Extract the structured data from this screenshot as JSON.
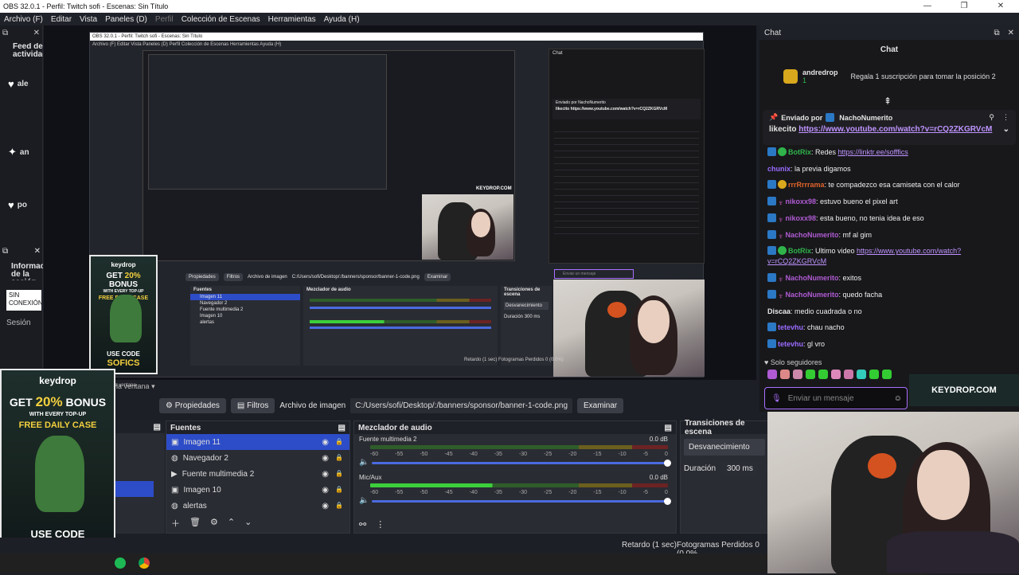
{
  "window": {
    "title": "OBS 32.0.1 - Perfil: Twitch sofi - Escenas: Sin Título",
    "controls": [
      "—",
      "❐",
      "✕"
    ]
  },
  "menu": {
    "items": [
      "Archivo (F)",
      "Editar",
      "Vista",
      "Paneles (D)",
      "Perfil",
      "Colección de Escenas",
      "Herramientas",
      "Ayuda (H)"
    ]
  },
  "left_dock": {
    "title": "Feed de actividad",
    "rows": [
      "ale",
      "an",
      "po"
    ],
    "info_title": "Información de la sesión",
    "status": "SIN CONEXIÓN",
    "session": "Sesión"
  },
  "preview": {
    "inner_title": "OBS 32.0.1 - Perfil: Twitch sofi - Escenas: Sin Título",
    "inner_menu": "Archivo (F)   Editar   Vista   Paneles (D)   Perfil   Colección de Escenas   Herramientas   Ayuda (H)",
    "inner_chat_title": "Chat",
    "inner_chat_pinned": "Enviado por NachoNumerito",
    "inner_chat_link": "likecito https://www.youtube.com/watch?v=rCQ2ZKGRVcM",
    "inner_chat_placeholder": "Enviar un mensaje",
    "inner_keydrop": "KEYDROP.COM",
    "inner_sources_title": "Fuentes",
    "inner_mixer_title": "Mezclador de audio",
    "inner_transitions_title": "Transiciones de escena",
    "inner_transition": "Desvanecimiento",
    "inner_duration": "Duración",
    "inner_duration_value": "300 ms",
    "inner_sources": [
      "Imagen 11",
      "Navegador 2",
      "Fuente multimedia 2",
      "Imagen 10",
      "alertas"
    ],
    "inner_btn_props": "Propiedades",
    "inner_btn_filters": "Filtros",
    "inner_file_label": "Archivo de imagen",
    "inner_path": "C:/Users/sofi/Desktop/:/banners/sponsor/banner-1-code.png",
    "inner_browse": "Examinar",
    "inner_status": "Retardo (1 sec)     Fotogramas Perdidos 0 (0.0%)",
    "window_label": "la ventana"
  },
  "ad": {
    "logo": "keydrop",
    "line1_a": "GET ",
    "line1_b": "20%",
    "line1_c": " BONUS",
    "line2": "WITH EVERY TOP-UP",
    "line3": "FREE DAILY CASE",
    "line4": "USE CODE",
    "line5": "SOFICS"
  },
  "controls": {
    "window_label": "la ventana",
    "properties": "Propiedades",
    "filters": "Filtros",
    "file_label": "Archivo de imagen",
    "path": "C:/Users/sofi/Desktop/:/banners/sponsor/banner-1-code.png",
    "browse": "Examinar"
  },
  "sources": {
    "title": "Fuentes",
    "items": [
      {
        "label": "Imagen 11",
        "selected": true,
        "icon": "image-icon"
      },
      {
        "label": "Navegador 2",
        "selected": false,
        "icon": "globe-icon"
      },
      {
        "label": "Fuente multimedia 2",
        "selected": false,
        "icon": "play-icon"
      },
      {
        "label": "Imagen 10",
        "selected": false,
        "icon": "image-icon"
      },
      {
        "label": "alertas",
        "selected": false,
        "icon": "globe-icon"
      }
    ]
  },
  "mixer": {
    "title": "Mezclador de audio",
    "channels": [
      {
        "name": "Fuente multimedia 2",
        "db": "0.0 dB",
        "level": 0.0
      },
      {
        "name": "Mic/Aux",
        "db": "0.0 dB",
        "level": 0.41
      }
    ],
    "scale": [
      "-60",
      "-55",
      "-50",
      "-45",
      "-40",
      "-35",
      "-30",
      "-25",
      "-20",
      "-15",
      "-10",
      "-5",
      "0"
    ]
  },
  "transitions": {
    "title": "Transiciones de escena",
    "selected": "Desvanecimiento",
    "duration_label": "Duración",
    "duration_value": "300 ms"
  },
  "status": {
    "delay": "Retardo (1 sec)",
    "frames": "Fotogramas Perdidos 0 (0.0%"
  },
  "chat": {
    "dock_title": "Chat",
    "header": "Chat",
    "gift_user": "andredrop",
    "gift_count": "1",
    "gift_text": "Regala 1 suscripción para tomar la posición 2",
    "pinned_by_label": "Enviado por",
    "pinned_by_user": "NachoNumerito",
    "pinned_text": "likecito",
    "pinned_link": "https://www.youtube.com/watch?v=rCQ2ZKGRVcM",
    "messages": [
      {
        "user": "BotRix",
        "sep": ": ",
        "text": "Redes ",
        "link": "https://linktr.ee/sofffics",
        "color": "g"
      },
      {
        "user": "chunix",
        "sep": ": ",
        "text": "la previa digamos",
        "link": "",
        "color": "v"
      },
      {
        "user": "rrrRrrrama",
        "sep": ": ",
        "text": "te compadezco esa camiseta con el calor",
        "link": "",
        "color": "o"
      },
      {
        "user": "nikoxx98",
        "sep": ": ",
        "text": "estuvo bueno el pixel art",
        "link": "",
        "color": "p"
      },
      {
        "user": "nikoxx98",
        "sep": ": ",
        "text": "esta bueno, no tenia idea de eso",
        "link": "",
        "color": "p"
      },
      {
        "user": "NachoNumerito",
        "sep": ": ",
        "text": "mf al gim",
        "link": "",
        "color": "p"
      },
      {
        "user": "BotRix",
        "sep": ": ",
        "text": "Ultimo video ",
        "link": "https://www.youtube.com/watch?v=rCQ2ZKGRVcM",
        "color": "g"
      },
      {
        "user": "NachoNumerito",
        "sep": ": ",
        "text": "exitos",
        "link": "",
        "color": "p"
      },
      {
        "user": "NachoNumerito",
        "sep": ": ",
        "text": "quedo facha",
        "link": "",
        "color": "p"
      },
      {
        "user": "Discaa",
        "sep": ": ",
        "text": "medio cuadrada o no",
        "link": "",
        "color": "w"
      },
      {
        "user": "tetevhu",
        "sep": ": ",
        "text": "chau nacho",
        "link": "",
        "color": "v"
      },
      {
        "user": "tetevhu",
        "sep": ": ",
        "text": "gl vro",
        "link": "",
        "color": "v"
      }
    ],
    "followers_only": "Solo seguidores",
    "placeholder": "Enviar un mensaje",
    "banner": "KEYDROP.COM"
  },
  "colors": {
    "accent": "#2d4cc8",
    "twitch": "#a970ff",
    "keydrop_yellow": "#f3d03e"
  }
}
